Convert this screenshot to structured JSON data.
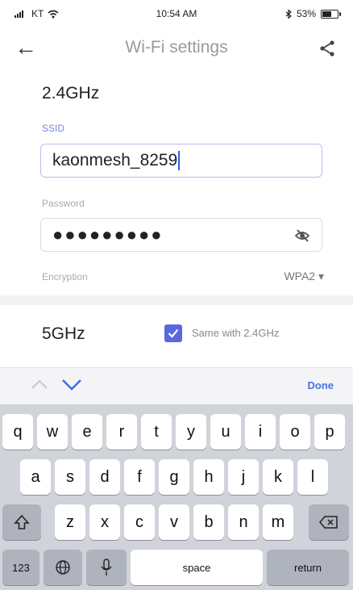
{
  "status": {
    "carrier": "KT",
    "time": "10:54 AM",
    "battery": "53%"
  },
  "nav": {
    "title": "Wi-Fi settings"
  },
  "band24": {
    "title": "2.4GHz",
    "ssid_label": "SSID",
    "ssid_value": "kaonmesh_8259",
    "password_label": "Password",
    "password_value": "●●●●●●●●●",
    "encryption_label": "Encryption",
    "encryption_value": "WPA2 ▾"
  },
  "band5": {
    "title": "5GHz",
    "same_label": "Same with 2.4GHz",
    "same_checked": true
  },
  "accessory": {
    "done_label": "Done"
  },
  "keyboard": {
    "row1": [
      "q",
      "w",
      "e",
      "r",
      "t",
      "y",
      "u",
      "i",
      "o",
      "p"
    ],
    "row2": [
      "a",
      "s",
      "d",
      "f",
      "g",
      "h",
      "j",
      "k",
      "l"
    ],
    "row3": [
      "z",
      "x",
      "c",
      "v",
      "b",
      "n",
      "m"
    ],
    "numbers_label": "123",
    "space_label": "space",
    "return_label": "return"
  },
  "colors": {
    "accent": "#5a68e0",
    "label_active": "#7b83e6",
    "done": "#4a6fe0",
    "keyboard_bg": "#d0d3da"
  }
}
